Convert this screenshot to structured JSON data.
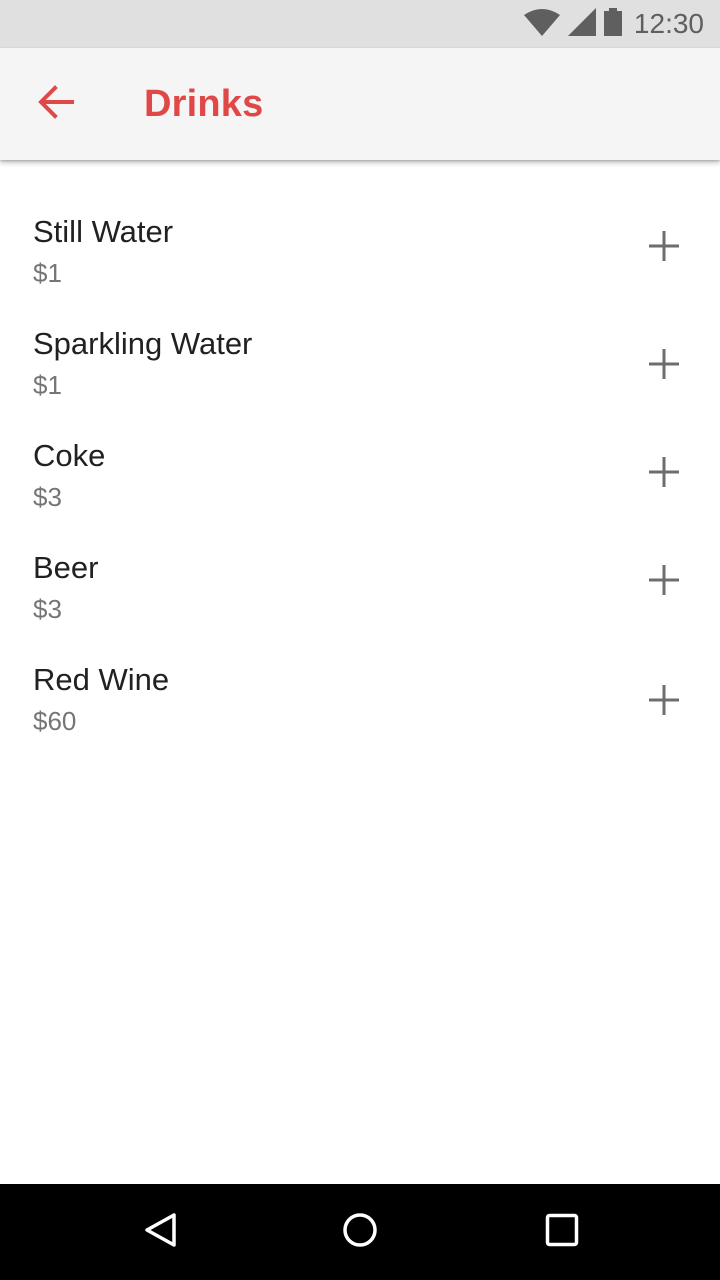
{
  "status_bar": {
    "time": "12:30",
    "icons": [
      "wifi-icon",
      "cell-signal-icon",
      "battery-icon"
    ]
  },
  "app_bar": {
    "title": "Drinks",
    "back_icon": "arrow-back-icon"
  },
  "items": [
    {
      "name": "Still Water",
      "price": "$1"
    },
    {
      "name": "Sparkling Water",
      "price": "$1"
    },
    {
      "name": "Coke",
      "price": "$3"
    },
    {
      "name": "Beer",
      "price": "$3"
    },
    {
      "name": "Red Wine",
      "price": "$60"
    }
  ],
  "item_action_icon": "plus-icon",
  "nav_bar": {
    "icons": [
      "back-triangle-icon",
      "home-circle-icon",
      "recents-square-icon"
    ]
  },
  "colors": {
    "accent": "#e04848",
    "app_bar_bg": "#f5f5f5",
    "status_bar_bg": "#e0e0e0",
    "nav_bar_bg": "#000000",
    "primary_text": "#212121",
    "secondary_text": "#757575",
    "icon_gray": "#6d6d6d"
  }
}
